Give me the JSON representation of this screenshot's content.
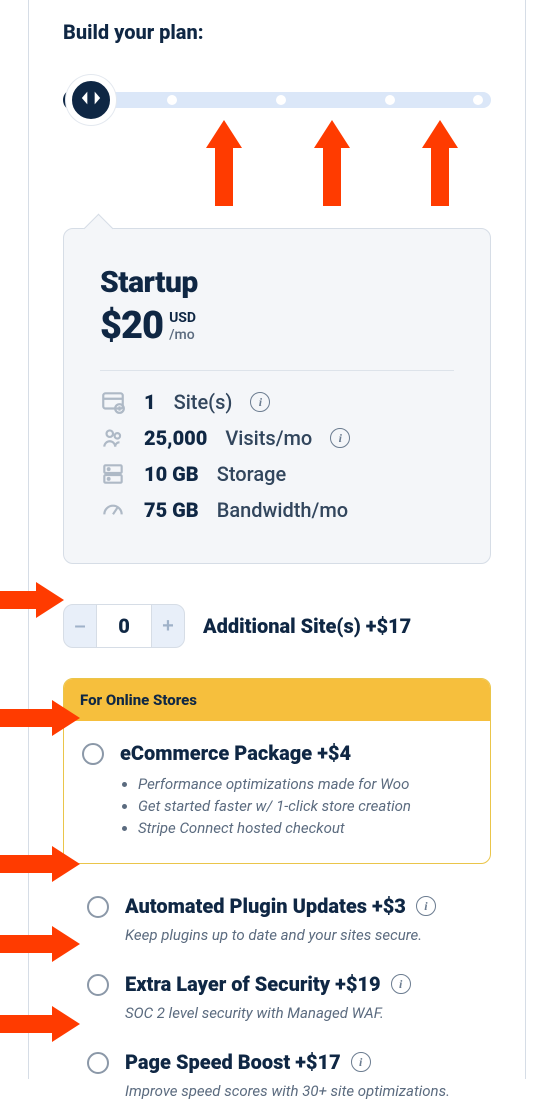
{
  "heading": "Build your plan:",
  "slider": {
    "notches": [
      25.5,
      51,
      76.5,
      100
    ]
  },
  "plan": {
    "name": "Startup",
    "price": "$20",
    "currency": "USD",
    "per": "/mo",
    "features": [
      {
        "value": "1",
        "label": "Site(s)",
        "info": true,
        "icon": "site"
      },
      {
        "value": "25,000",
        "label": "Visits/mo",
        "info": true,
        "icon": "visits"
      },
      {
        "value": "10 GB",
        "label": "Storage",
        "info": false,
        "icon": "storage"
      },
      {
        "value": "75 GB",
        "label": "Bandwidth/mo",
        "info": false,
        "icon": "bandwidth"
      }
    ]
  },
  "stepper": {
    "count": "0",
    "minus": "–",
    "plus": "+",
    "label": "Additional Site(s) +$17"
  },
  "ecommerce": {
    "banner": "For Online Stores",
    "title": "eCommerce Package +$4",
    "bullets": [
      "Performance optimizations made for Woo",
      "Get started faster w/ 1-click store creation",
      "Stripe Connect hosted checkout"
    ]
  },
  "addons": [
    {
      "title": "Automated Plugin Updates +$3",
      "desc": "Keep plugins up to date and your sites secure.",
      "info": true
    },
    {
      "title": "Extra Layer of Security +$19",
      "desc": "SOC 2 level security with Managed WAF.",
      "info": true
    },
    {
      "title": "Page Speed Boost +$17",
      "desc": "Improve speed scores with 30+ site optimizations.",
      "info": true
    }
  ]
}
